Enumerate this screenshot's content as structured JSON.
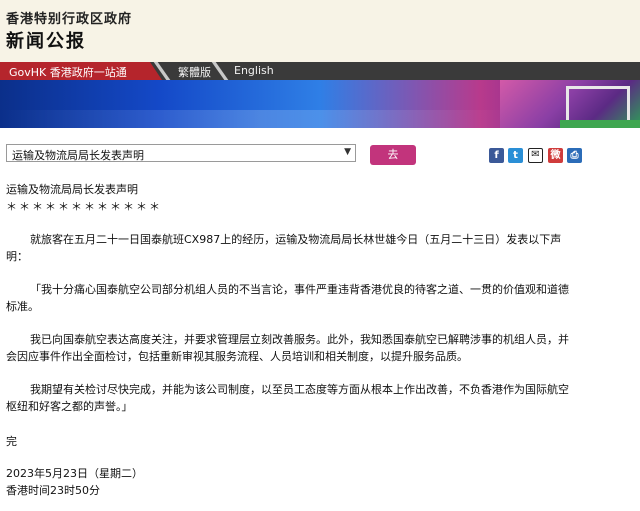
{
  "header": {
    "gov_name": "香港特别行政区政府",
    "site_title": "新闻公报"
  },
  "nav": {
    "govhk_label": "GovHK 香港政府一站通",
    "traditional_label": "繁體版",
    "english_label": "English"
  },
  "toolbar": {
    "select_value": "运输及物流局局长发表声明",
    "go_label": "去"
  },
  "share": {
    "facebook": "f",
    "twitter": "t",
    "email": "✉",
    "weibo": "微",
    "print": "⎙"
  },
  "article": {
    "title": "运输及物流局局长发表声明",
    "stars": "＊＊＊＊＊＊＊＊＊＊＊＊",
    "intro_line1": "就旅客在五月二十一日国泰航班CX987上的经历，运输及物流局局长林世雄今日（五月二十三日）发表以下声",
    "intro_line2": "明：",
    "quote1_line1": "「我十分痛心国泰航空公司部分机组人员的不当言论，事件严重违背香港优良的待客之道、一贯的价值观和道德",
    "quote1_line2": "标准。",
    "quote2_line1": "我已向国泰航空表达高度关注，并要求管理层立刻改善服务。此外，我知悉国泰航空已解聘涉事的机组人员，并",
    "quote2_line2": "会因应事件作出全面检讨，包括重新审视其服务流程、人员培训和相关制度，以提升服务品质。",
    "quote3_line1": "我期望有关检讨尽快完成，并能为该公司制度，以至员工态度等方面从根本上作出改善，不负香港作为国际航空",
    "quote3_line2": "枢纽和好客之都的声誉。」",
    "end_mark": "完",
    "date": "2023年5月23日（星期二）",
    "time": "香港时间23时50分"
  },
  "colors": {
    "govhk_red": "#b5252c",
    "go_button": "#c2347c",
    "nav_bg": "#3a3a3a",
    "header_bg": "#f7f3e6"
  }
}
